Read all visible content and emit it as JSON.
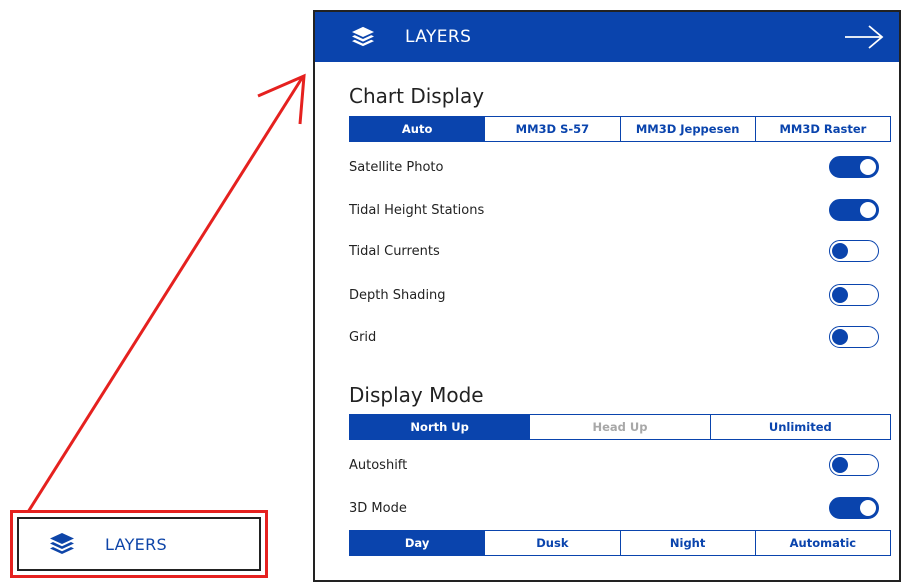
{
  "callout": {
    "icon": "layers-icon",
    "label": "LAYERS",
    "highlight_color": "#e5211f"
  },
  "panel": {
    "header": {
      "icon": "layers-icon",
      "title": "LAYERS",
      "close_icon": "arrow-right-icon",
      "background": "#0a44ad"
    },
    "chart_display": {
      "title": "Chart Display",
      "options": [
        "Auto",
        "MM3D S-57",
        "MM3D Jeppesen",
        "MM3D Raster"
      ],
      "selected": "Auto"
    },
    "layer_toggles": [
      {
        "label": "Satellite Photo",
        "on": true
      },
      {
        "label": "Tidal Height Stations",
        "on": true
      },
      {
        "label": "Tidal Currents",
        "on": false
      },
      {
        "label": "Depth Shading",
        "on": false
      },
      {
        "label": "Grid",
        "on": false
      }
    ],
    "display_mode": {
      "title": "Display Mode",
      "options": [
        "North Up",
        "Head Up",
        "Unlimited"
      ],
      "selected": "North Up",
      "disabled": [
        "Head Up"
      ]
    },
    "mode_toggles": [
      {
        "label": "Autoshift",
        "on": false
      },
      {
        "label": "3D Mode",
        "on": true
      }
    ],
    "color_mode": {
      "options": [
        "Day",
        "Dusk",
        "Night",
        "Automatic"
      ],
      "selected": "Day"
    }
  }
}
